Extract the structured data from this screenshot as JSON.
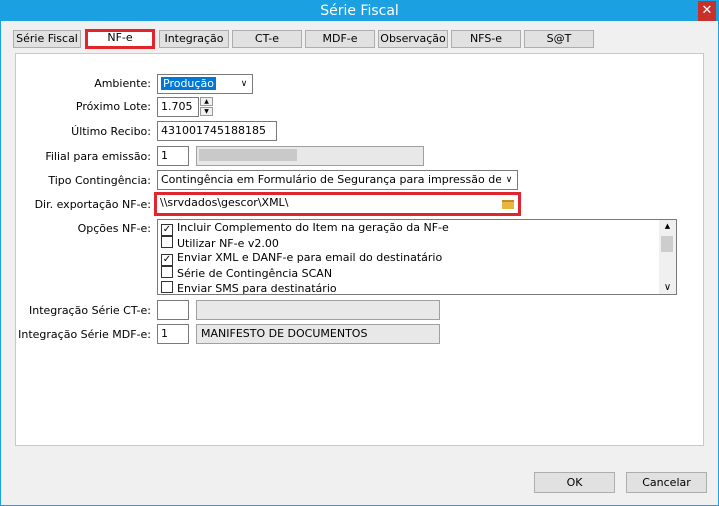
{
  "window": {
    "title": "Série Fiscal",
    "close_symbol": "✕"
  },
  "tabs": [
    {
      "label": "Série Fiscal"
    },
    {
      "label": "NF-e"
    },
    {
      "label": "Integração"
    },
    {
      "label": "CT-e"
    },
    {
      "label": "MDF-e"
    },
    {
      "label": "Observação"
    },
    {
      "label": "NFS-e"
    },
    {
      "label": "S@T"
    }
  ],
  "form": {
    "ambiente": {
      "label": "Ambiente:",
      "value": "Produção"
    },
    "proximo_lote": {
      "label": "Próximo Lote:",
      "value": "1.705"
    },
    "ultimo_recibo": {
      "label": "Último Recibo:",
      "value": "431001745188185"
    },
    "filial": {
      "label": "Filial para emissão:",
      "value": "1"
    },
    "tipo_contingencia": {
      "label": "Tipo Contingência:",
      "value": "Contingência em Formulário de Segurança para impressão de DAI"
    },
    "dir_exportacao": {
      "label": "Dir. exportação NF-e:",
      "value": "\\\\srvdados\\gescor\\XML\\"
    },
    "opcoes": {
      "label": "Opções NF-e:",
      "items": [
        {
          "label": "Incluir Complemento do Item na geração da NF-e",
          "checked": true
        },
        {
          "label": "Utilizar NF-e v2.00",
          "checked": false
        },
        {
          "label": "Enviar XML e DANF-e para email do destinatário",
          "checked": true
        },
        {
          "label": "Série de Contingência SCAN",
          "checked": false
        },
        {
          "label": "Enviar SMS para destinatário",
          "checked": false
        }
      ]
    },
    "integracao_cte": {
      "label": "Integração Série CT-e:",
      "value": "",
      "description": ""
    },
    "integracao_mdfe": {
      "label": "Integração Série MDF-e:",
      "value": "1",
      "description": "MANIFESTO DE DOCUMENTOS"
    }
  },
  "buttons": {
    "ok": "OK",
    "cancel": "Cancelar"
  },
  "glyphs": {
    "check": "✓",
    "dropdown": "∨",
    "up": "▲",
    "down": "▼"
  }
}
